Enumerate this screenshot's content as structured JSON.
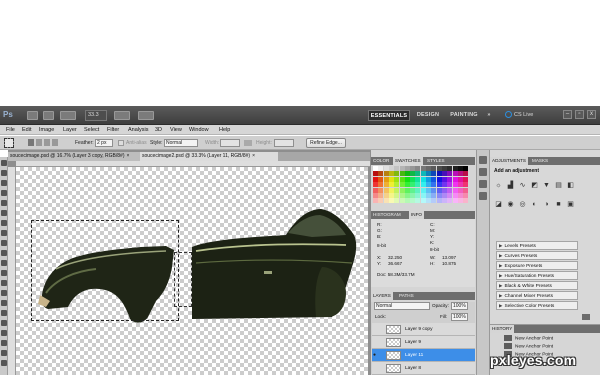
{
  "app": {
    "logo": "Ps",
    "zoom": "33.3"
  },
  "workspaces": {
    "essentials": "ESSENTIALS",
    "design": "DESIGN",
    "painting": "PAINTING",
    "more": "»"
  },
  "cslive": "CS Live",
  "window_controls": {
    "minimize": "–",
    "restore": "▫",
    "close": "x"
  },
  "menu": [
    "File",
    "Edit",
    "Image",
    "Layer",
    "Select",
    "Filter",
    "Analysis",
    "3D",
    "View",
    "Window",
    "Help"
  ],
  "options": {
    "feather_label": "Feather:",
    "feather_value": "2 px",
    "antialias_label": "Anti-alias",
    "style_label": "Style:",
    "style_value": "Normal",
    "width_label": "Width:",
    "height_label": "Height:",
    "refine_edge": "Refine Edge..."
  },
  "doc_tabs": [
    {
      "title": "soucecimage.psd @ 16.7% (Layer 3 copy, RGB/8#)",
      "close": "×"
    },
    {
      "title": "soucecimage2.psd @ 33.3% (Layer 11, RGB/8#)",
      "close": "×"
    }
  ],
  "panels": {
    "top_tabs": [
      "COLOR",
      "SWATCHES",
      "STYLES"
    ],
    "info_tabs": [
      "HISTOGRAM",
      "INFO"
    ],
    "layers_tabs": [
      "LAYERS",
      "PATHS"
    ],
    "adj_tabs": [
      "ADJUSTMENTS",
      "MASKS"
    ],
    "history_tab": "HISTORY"
  },
  "info": {
    "r": "R:",
    "g": "G:",
    "b": "B:",
    "c": "C:",
    "m": "M:",
    "y": "Y:",
    "k": "K:",
    "bit1": "8-bit",
    "bit2": "8-bit",
    "x": "X:",
    "y_coord": "Y:",
    "w": "W:",
    "h": "H:",
    "x_val": "32.250",
    "y_val": "36.667",
    "w_val": "13.097",
    "h_val": "10.875",
    "doc": "Doc: 58.3M/33.7M"
  },
  "layers": {
    "blend_mode": "Normal",
    "opacity_label": "Opacity:",
    "opacity_value": "100%",
    "lock_label": "Lock:",
    "fill_label": "Fill:",
    "fill_value": "100%",
    "items": [
      "Layer 9 copy",
      "Layer 9",
      "Layer 11",
      "Layer 8"
    ]
  },
  "adjustments": {
    "heading": "Add an adjustment",
    "presets": [
      "Levels Presets",
      "Curves Presets",
      "Exposure Presets",
      "Hue/Saturation Presets",
      "Black & White Presets",
      "Channel Mixer Presets",
      "Selective Color Presets"
    ]
  },
  "history": [
    "New Anchor Point",
    "New Anchor Point",
    "New Anchor Point"
  ],
  "watermark": "pxleyes.com",
  "colors": {
    "accent": "#3d8ee8",
    "appbar": "#4a4a4a",
    "panel": "#d5d5d5"
  }
}
